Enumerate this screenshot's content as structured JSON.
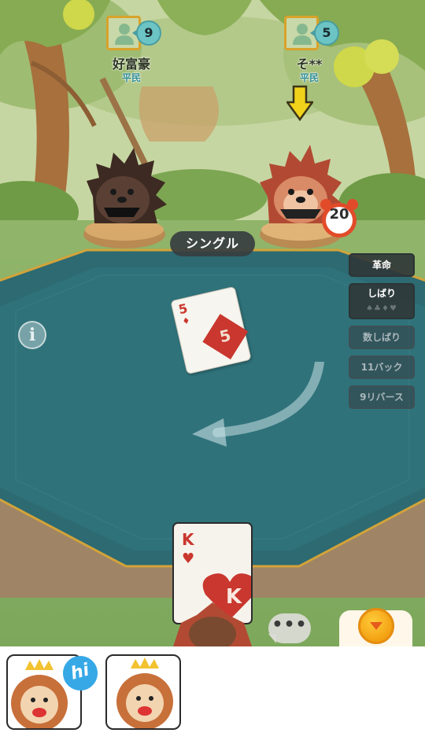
{
  "players": [
    {
      "name": "好富豪",
      "rank": "平民",
      "card_count": "9",
      "state": "waiting"
    },
    {
      "name": "そ**",
      "rank": "平民",
      "card_count": "5",
      "state": "current-turn"
    }
  ],
  "turn_timer": "20",
  "play_type": "シングル",
  "rules": [
    {
      "label": "革命",
      "active": true
    },
    {
      "label": "しばり",
      "active": true,
      "suits": "♠♣♦♥"
    },
    {
      "label": "数しばり",
      "active": false
    },
    {
      "label": "11バック",
      "active": false
    },
    {
      "label": "9リバース",
      "active": false
    }
  ],
  "played_card": {
    "rank": "5",
    "suit": "♦",
    "suit_name": "diamond"
  },
  "hand_card": {
    "rank": "K",
    "suit": "♥",
    "suit_name": "heart"
  },
  "chat_button": "•••",
  "stickers": [
    {
      "name": "lion-king-hi",
      "badge": "hi"
    },
    {
      "name": "lion-king-cheer"
    }
  ],
  "colors": {
    "table": "#2d6a72",
    "table_rim": "#d2a33a",
    "card_red": "#c9372e",
    "badge": "#6cc4c4",
    "rank_text": "#2f8d97"
  }
}
